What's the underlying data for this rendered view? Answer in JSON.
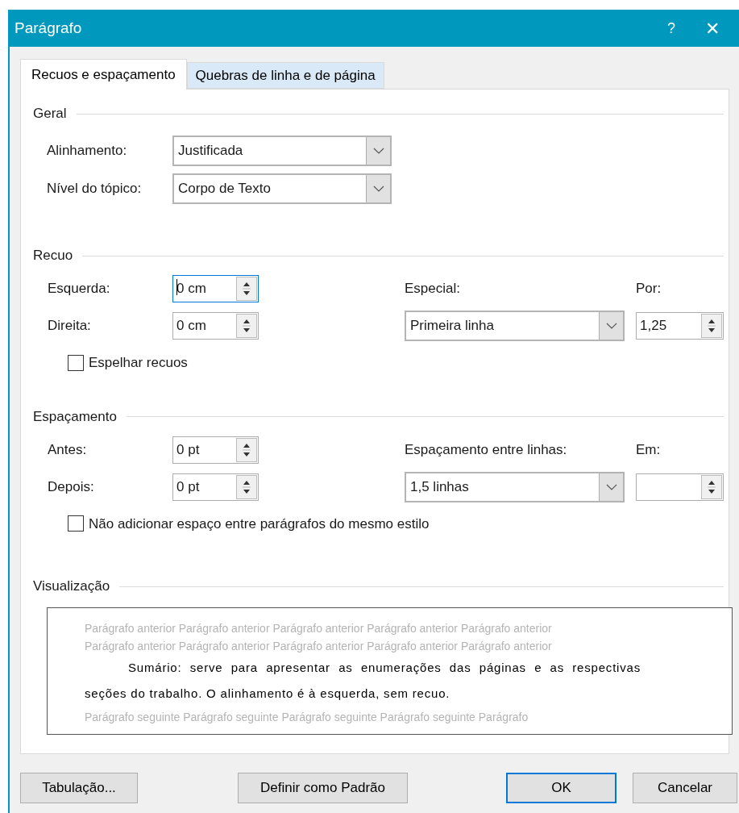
{
  "window": {
    "title": "Parágrafo",
    "help": "?",
    "close": "✕"
  },
  "tabs": [
    {
      "label": "Recuos e espaçamento",
      "selected": true
    },
    {
      "label": "Quebras de linha e de página",
      "selected": false
    }
  ],
  "general": {
    "title": "Geral",
    "fields": [
      {
        "label": "Alinhamento:",
        "value": "Justificada"
      },
      {
        "label": "Nível do tópico:",
        "value": "Corpo de Texto"
      }
    ]
  },
  "indentation": {
    "title": "Recuo",
    "spinners": [
      {
        "label": "Esquerda:",
        "value": "0 cm",
        "focused": true
      },
      {
        "label": "Direita:",
        "value": "0 cm",
        "focused": false
      }
    ],
    "special": {
      "label": "Especial:",
      "value": "Primeira linha"
    },
    "by": {
      "label": "Por:",
      "value": "1,25"
    },
    "checkbox": {
      "label": "Espelhar recuos",
      "checked": false
    }
  },
  "spacing": {
    "title": "Espaçamento",
    "spinners": [
      {
        "label": "Antes:",
        "value": "0 pt",
        "focused": false
      },
      {
        "label": "Depois:",
        "value": "0 pt",
        "focused": false
      }
    ],
    "line_spacing": {
      "label": "Espaçamento entre linhas:",
      "value": "1,5 linhas"
    },
    "at": {
      "label": "Em:"
    },
    "checkbox": {
      "label": "Não adicionar espaço entre parágrafos do mesmo estilo",
      "checked": false
    }
  },
  "preview": {
    "title": "Visualização",
    "previous": [
      "Parágrafo anterior Parágrafo anterior Parágrafo anterior Parágrafo anterior Parágrafo anterior",
      "Parágrafo anterior Parágrafo anterior Parágrafo anterior Parágrafo anterior Parágrafo anterior"
    ],
    "current": "Sumário: serve para apresentar as enumerações das páginas e as respectivas seções do trabalho. O alinhamento é à esquerda, sem recuo.",
    "next": "Parágrafo seguinte Parágrafo seguinte Parágrafo seguinte Parágrafo seguinte Parágrafo"
  },
  "buttons": [
    {
      "label": "Tabulação...",
      "default": false
    },
    {
      "label": "Definir como Padrão",
      "default": false
    },
    {
      "label": "OK",
      "default": true
    },
    {
      "label": "Cancelar",
      "default": false
    }
  ]
}
